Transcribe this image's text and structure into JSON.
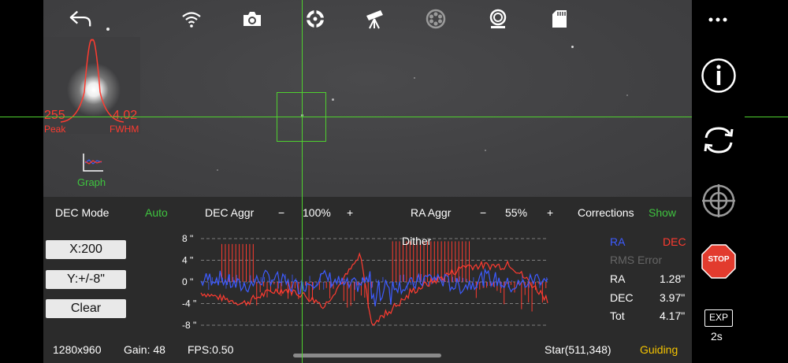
{
  "toolbar": {
    "icons": [
      "back-icon",
      "wifi-icon",
      "camera-icon",
      "target-scope-icon",
      "telescope-icon",
      "filter-wheel-icon",
      "focuser-icon",
      "sd-card-icon"
    ]
  },
  "star_profile": {
    "peak_value": "255",
    "peak_label": "Peak",
    "fwhm_value": "4.02",
    "fwhm_label": "FWHM"
  },
  "graph_button": {
    "label": "Graph"
  },
  "controls": {
    "dec_mode_label": "DEC Mode",
    "dec_mode_value": "Auto",
    "dec_aggr_label": "DEC Aggr",
    "dec_aggr_minus": "−",
    "dec_aggr_value": "100%",
    "dec_aggr_plus": "+",
    "ra_aggr_label": "RA Aggr",
    "ra_aggr_minus": "−",
    "ra_aggr_value": "55%",
    "ra_aggr_plus": "+",
    "corrections_label": "Corrections",
    "corrections_value": "Show"
  },
  "graph_buttons": {
    "x_scale": "X:200",
    "y_scale": "Y:+/-8\"",
    "clear": "Clear"
  },
  "chart_data": {
    "type": "line",
    "ylim": [
      -8,
      8
    ],
    "yticks": [
      "8 \"",
      "4 \"",
      "0 \"",
      "-4 \"",
      "-8 \""
    ],
    "annotation": "Dither",
    "series": [
      {
        "name": "RA",
        "color": "#3d5bff"
      },
      {
        "name": "DEC",
        "color": "#ff3b30"
      }
    ]
  },
  "legend": {
    "ra": "RA",
    "dec": "DEC"
  },
  "rms": {
    "title": "RMS Error",
    "ra_label": "RA",
    "ra_value": "1.28\"",
    "dec_label": "DEC",
    "dec_value": "3.97\"",
    "tot_label": "Tot",
    "tot_value": "4.17\""
  },
  "status": {
    "resolution": "1280x960",
    "gain": "Gain: 48",
    "fps": "FPS:0.50",
    "star": "Star(511,348)",
    "state": "Guiding"
  },
  "sidebar": {
    "exposure_label": "EXP",
    "exposure_value": "2s",
    "stop_label": "STOP"
  },
  "colors": {
    "crosshair": "#4fd12f",
    "ra": "#3d5bff",
    "dec": "#ff3b30",
    "accent_green": "#3fc53f",
    "guiding": "#f5c400"
  }
}
